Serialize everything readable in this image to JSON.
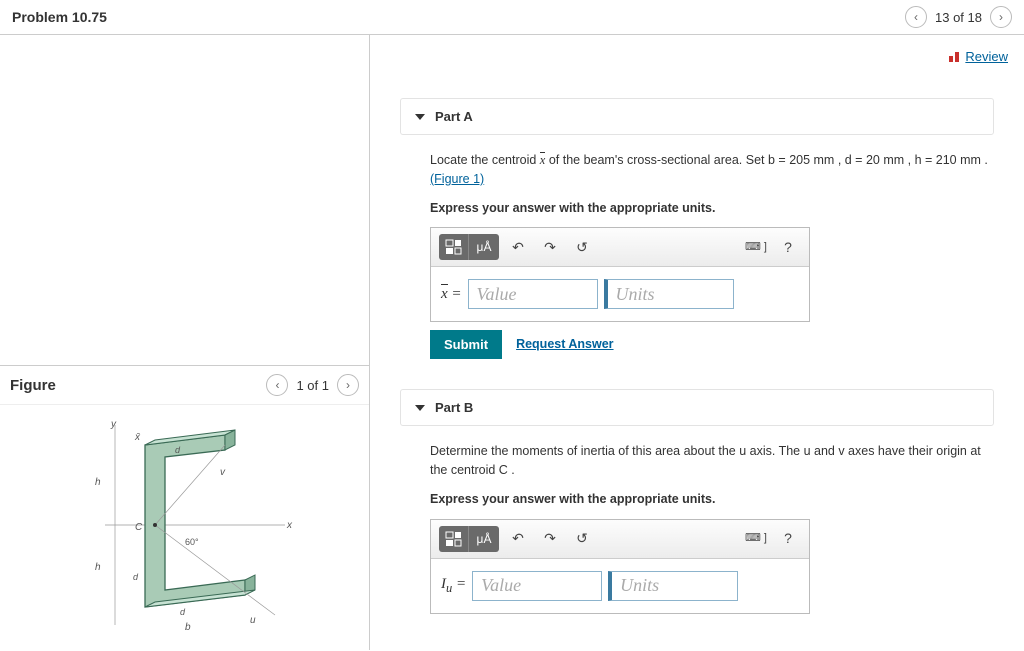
{
  "header": {
    "title": "Problem 10.75",
    "position": "13 of 18"
  },
  "review_label": "Review",
  "figure": {
    "title": "Figure",
    "position": "1 of 1"
  },
  "partA": {
    "title": "Part A",
    "prompt_pre": "Locate the centroid ",
    "prompt_var": "x̄",
    "prompt_post": " of the beam's cross-sectional area. Set b = 205 mm , d = 20 mm , h = 210 mm .",
    "figure_link": "(Figure 1)",
    "instruct": "Express your answer with the appropriate units.",
    "var_label": "x̄ =",
    "value_ph": "Value",
    "units_ph": "Units",
    "submit": "Submit",
    "request": "Request Answer"
  },
  "partB": {
    "title": "Part B",
    "prompt": "Determine the moments of inertia of this area about the u axis. The u and v axes have their origin at the centroid C .",
    "instruct": "Express your answer with the appropriate units.",
    "var_label": "Iᵤ =",
    "value_ph": "Value",
    "units_ph": "Units"
  },
  "toolbar": {
    "templates": "⬚",
    "symbols": "μÅ",
    "undo": "↶",
    "redo": "↷",
    "reset": "↺",
    "keyboard": "⌨ ]",
    "help": "?"
  }
}
